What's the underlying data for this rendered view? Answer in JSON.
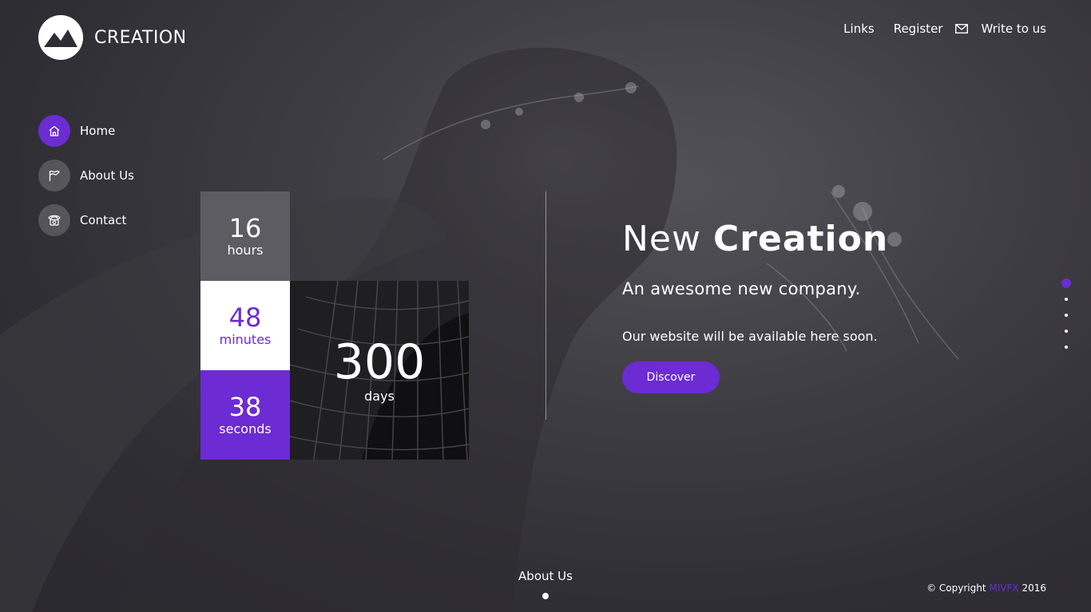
{
  "brand": {
    "name": "CREATION",
    "accent_color": "#6c2bd3"
  },
  "topnav": {
    "links": "Links",
    "register": "Register",
    "write": "Write to us"
  },
  "sidenav": {
    "items": [
      {
        "label": "Home",
        "icon": "home-icon",
        "active": true
      },
      {
        "label": "About Us",
        "icon": "flag-icon",
        "active": false
      },
      {
        "label": "Contact",
        "icon": "phone-icon",
        "active": false
      }
    ]
  },
  "countdown": {
    "hours": {
      "value": "16",
      "unit": "hours"
    },
    "minutes": {
      "value": "48",
      "unit": "minutes"
    },
    "seconds": {
      "value": "38",
      "unit": "seconds"
    },
    "days": {
      "value": "300",
      "unit": "days"
    }
  },
  "hero": {
    "title_light": "New",
    "title_bold": "Creation",
    "subtitle": "An awesome new company.",
    "description": "Our website will be available here soon.",
    "cta": "Discover"
  },
  "pager": {
    "count": 5,
    "active_index": 0
  },
  "bottom": {
    "link": "About Us"
  },
  "footer": {
    "prefix": "© Copyright",
    "brand": "MIVFX",
    "year": "2016"
  }
}
